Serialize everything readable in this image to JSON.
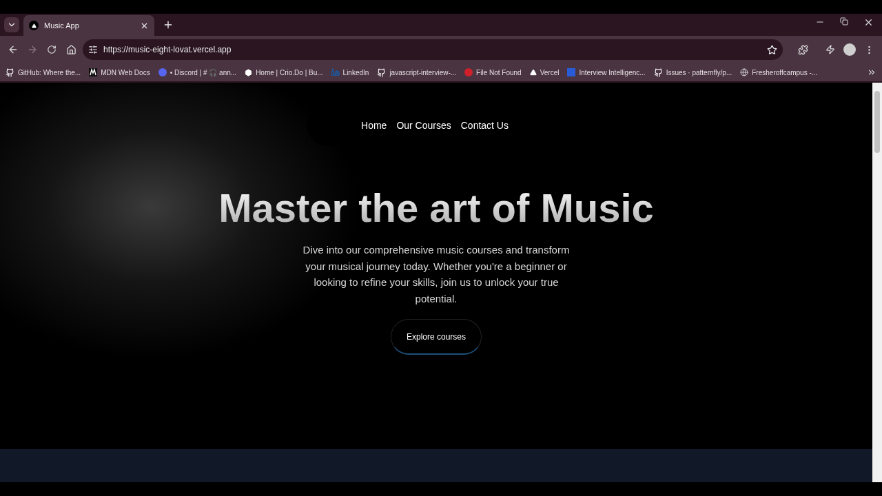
{
  "browser": {
    "tabs": [
      {
        "title": "Music App",
        "selected": true
      }
    ],
    "address": "https://music-eight-lovat.vercel.app",
    "bookmarks": [
      {
        "label": "GitHub: Where the..."
      },
      {
        "label": "MDN Web Docs"
      },
      {
        "label": "• Discord | # 🎧 ann..."
      },
      {
        "label": "Home | Crio.Do | Bu..."
      },
      {
        "label": "LinkedIn"
      },
      {
        "label": "javascript-interview-..."
      },
      {
        "label": "File Not Found"
      },
      {
        "label": "Vercel"
      },
      {
        "label": "Interview Intelligenc..."
      },
      {
        "label": "Issues · patternfly/p..."
      },
      {
        "label": "Fresheroffcampus -..."
      }
    ]
  },
  "page": {
    "nav": [
      {
        "label": "Home"
      },
      {
        "label": "Our Courses"
      },
      {
        "label": "Contact Us"
      }
    ],
    "title": "Master the art of Music",
    "subtitle": "Dive into our comprehensive music courses and transform your musical journey today. Whether you're a beginner or looking to refine your skills, join us to unlock your true potential.",
    "cta": "Explore courses"
  }
}
